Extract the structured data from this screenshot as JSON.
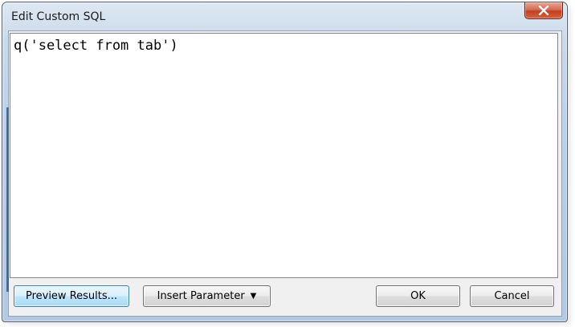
{
  "window": {
    "title": "Edit Custom SQL"
  },
  "editor": {
    "sql_text": "q('select from tab')"
  },
  "buttons": {
    "preview_label": "Preview Results...",
    "insert_parameter_label": "Insert Parameter",
    "insert_parameter_caret": "▼",
    "ok_label": "OK",
    "cancel_label": "Cancel"
  },
  "icons": {
    "close": "close-icon",
    "dropdown": "caret-down-icon"
  },
  "colors": {
    "close_button": "#c4401f",
    "focused_button_border": "#3c7fb1",
    "window_frame": "#b3c9e2"
  }
}
